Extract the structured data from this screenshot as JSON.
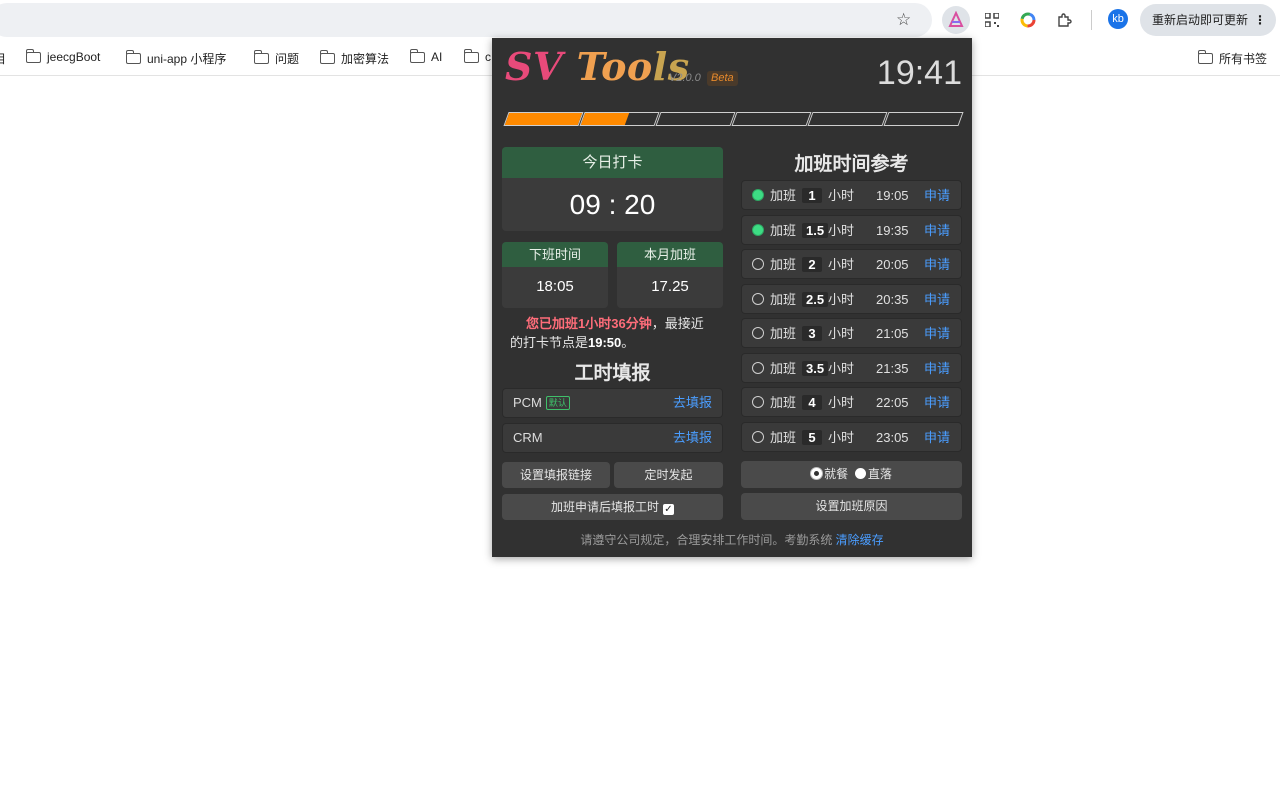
{
  "browser": {
    "update_label": "重新启动即可更新",
    "avatar_text": "kb",
    "bookmarks": [
      "jeecgBoot",
      "uni-app 小程序",
      "问题",
      "加密算法",
      "AI",
      "c"
    ],
    "all_bookmarks_label": "所有书签",
    "left_cut_label": "目"
  },
  "popup": {
    "logo_part1": "SV ",
    "logo_part2": "Too",
    "logo_part3": "ls",
    "version": "V2.0.0",
    "beta": "Beta",
    "clock": "19:41",
    "progress": [
      1,
      0.6,
      0,
      0,
      0,
      0
    ],
    "checkin": {
      "label": "今日打卡",
      "time": "09 : 20"
    },
    "offwork": {
      "label": "下班时间",
      "value": "18:05"
    },
    "month_ot": {
      "label": "本月加班",
      "value": "17.25"
    },
    "message": {
      "prefix": "您已加班",
      "duration": "1小时36分钟",
      "middle": "，最接近的打卡节点是",
      "node": "19:50",
      "suffix": "。"
    },
    "timesheet_title": "工时填报",
    "timesheet_rows": [
      {
        "name": "PCM",
        "tag": "默认",
        "link": "去填报"
      },
      {
        "name": "CRM",
        "tag": "",
        "link": "去填报"
      }
    ],
    "set_link_btn": "设置填报链接",
    "schedule_btn": "定时发起",
    "after_apply_btn": "加班申请后填报工时",
    "ot_title": "加班时间参考",
    "ot_rows": [
      {
        "done": true,
        "prefix": "加班",
        "hours": "1",
        "unit": "小时",
        "time": "19:05",
        "action": "申请"
      },
      {
        "done": true,
        "prefix": "加班",
        "hours": "1.5",
        "unit": "小时",
        "time": "19:35",
        "action": "申请"
      },
      {
        "done": false,
        "prefix": "加班",
        "hours": "2",
        "unit": "小时",
        "time": "20:05",
        "action": "申请"
      },
      {
        "done": false,
        "prefix": "加班",
        "hours": "2.5",
        "unit": "小时",
        "time": "20:35",
        "action": "申请"
      },
      {
        "done": false,
        "prefix": "加班",
        "hours": "3",
        "unit": "小时",
        "time": "21:05",
        "action": "申请"
      },
      {
        "done": false,
        "prefix": "加班",
        "hours": "3.5",
        "unit": "小时",
        "time": "21:35",
        "action": "申请"
      },
      {
        "done": false,
        "prefix": "加班",
        "hours": "4",
        "unit": "小时",
        "time": "22:05",
        "action": "申请"
      },
      {
        "done": false,
        "prefix": "加班",
        "hours": "5",
        "unit": "小时",
        "time": "23:05",
        "action": "申请"
      }
    ],
    "radio_dine": "就餐",
    "radio_home": "直落",
    "reason_btn": "设置加班原因",
    "footer_text": "请遵守公司规定，合理安排工作时间。考勤系统",
    "footer_link": "清除缓存"
  }
}
